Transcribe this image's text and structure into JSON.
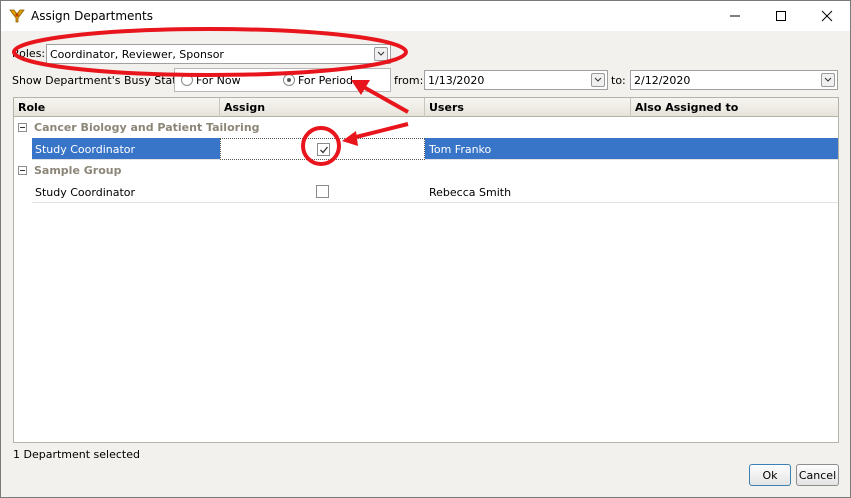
{
  "window": {
    "title": "Assign Departments"
  },
  "roles": {
    "label": "Roles:",
    "value": "Coordinator, Reviewer, Sponsor"
  },
  "busy_status": {
    "label": "Show Department's Busy Status:",
    "options": [
      {
        "label": "For Now",
        "checked": false
      },
      {
        "label": "For Period",
        "checked": true
      }
    ],
    "from_label": "from:",
    "from_value": "1/13/2020",
    "to_label": "to:",
    "to_value": "2/12/2020"
  },
  "grid": {
    "columns": [
      "Role",
      "Assign",
      "Users",
      "Also Assigned to"
    ],
    "groups": [
      {
        "name": "Cancer Biology and Patient Tailoring",
        "rows": [
          {
            "role": "Study Coordinator",
            "assigned": true,
            "users": "Tom Franko",
            "also_assigned": "",
            "selected": true
          }
        ]
      },
      {
        "name": "Sample Group",
        "rows": [
          {
            "role": "Study Coordinator",
            "assigned": false,
            "users": "Rebecca Smith",
            "also_assigned": "",
            "selected": false
          }
        ]
      }
    ]
  },
  "status_text": "1 Department selected",
  "buttons": {
    "ok": "Ok",
    "cancel": "Cancel"
  },
  "colors": {
    "selection": "#3874c8",
    "annotation": "#e8161c",
    "group_text": "#8b8678"
  }
}
